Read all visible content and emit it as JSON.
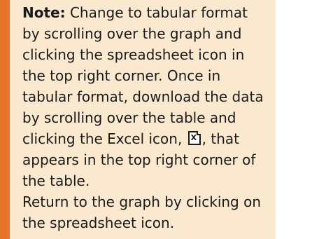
{
  "note": {
    "label": "Note:",
    "text_part1": " Change to tabular format by scrolling over the graph and clicking the spreadsheet icon in the top right corner. Once in tabular format, download the data by scrolling over the table and clicking the Excel icon,",
    "excel_icon_glyph": "X",
    "text_part2": ", that appears in the top right corner of the table.",
    "text_part3": "Return to the graph by clicking on the spreadsheet icon."
  },
  "colors": {
    "accent_border": "#e8742a",
    "panel_background": "#fbe9cf"
  },
  "icons": {
    "excel": "excel-icon"
  }
}
